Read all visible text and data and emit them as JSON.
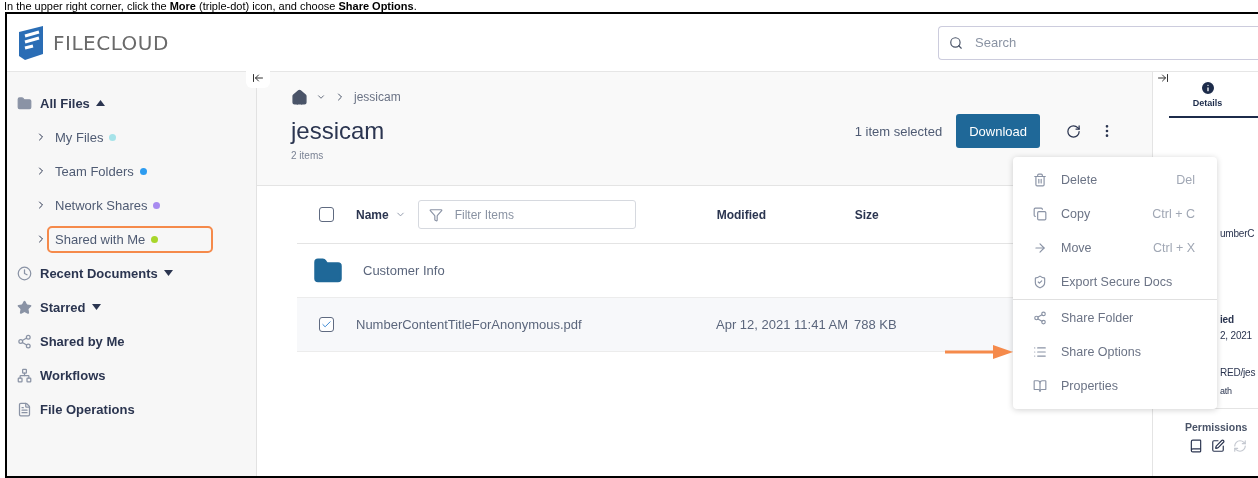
{
  "caption": "In the upper right corner, click the **More** (triple-dot) icon, and choose **Share Options**.",
  "header": {
    "logo": "FILECLOUD",
    "search": {
      "placeholder": "Search"
    }
  },
  "sidebar": {
    "items": [
      {
        "label": "All Files",
        "expanded": true,
        "children": [
          {
            "label": "My Files",
            "color": "#a6e3e9",
            "highlighted": false
          },
          {
            "label": "Team Folders",
            "color": "#2d9cf0",
            "highlighted": false
          },
          {
            "label": "Network Shares",
            "color": "#a88bf0",
            "highlighted": false
          },
          {
            "label": "Shared with Me",
            "color": "#a8d62b",
            "highlighted": true
          }
        ]
      },
      {
        "label": "Recent Documents",
        "expanded": false
      },
      {
        "label": "Starred",
        "expanded": false
      },
      {
        "label": "Shared by Me"
      },
      {
        "label": "Workflows"
      },
      {
        "label": "File Operations"
      }
    ]
  },
  "main": {
    "breadcrumb": "jessicam",
    "title": "jessicam",
    "count": "2 items",
    "selection": "1 item selected",
    "download": "Download",
    "table": {
      "select_all": false,
      "columns": [
        "Name",
        "Modified",
        "Size"
      ],
      "filter_placeholder": "Filter Items",
      "rows": [
        {
          "kind": "folder",
          "name": "Customer Info"
        },
        {
          "kind": "file",
          "name": "NumberContentTitleForAnonymous.pdf",
          "modified": "Apr 12, 2021 11:41 AM",
          "size": "788 KB",
          "checked": true
        }
      ]
    }
  },
  "menu": {
    "groups": [
      [
        {
          "label": "Delete",
          "shortcut": "Del"
        },
        {
          "label": "Copy",
          "shortcut": "Ctrl + C"
        },
        {
          "label": "Move",
          "shortcut": "Ctrl + X"
        },
        {
          "label": "Export Secure Docs"
        }
      ],
      [
        {
          "label": "Share Folder"
        },
        {
          "label": "Share Options"
        },
        {
          "label": "Properties"
        }
      ]
    ]
  },
  "details": {
    "tab": "Details",
    "texts": [
      {
        "kind": "plain",
        "text": "umberC"
      },
      {
        "kind": "bold",
        "text": "ied"
      },
      {
        "kind": "plain",
        "text": "2, 2021"
      },
      {
        "kind": "plain",
        "text": "RED/jes"
      },
      {
        "kind": "small",
        "text": "ath"
      }
    ],
    "permissions": "Permissions"
  }
}
